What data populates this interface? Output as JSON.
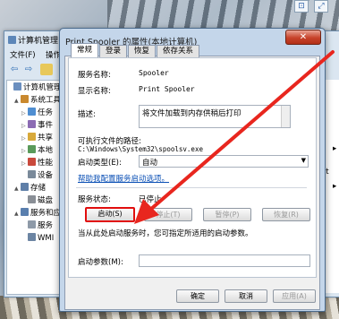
{
  "desktop": {
    "corner_buttons": [
      "⊡",
      "⤢"
    ]
  },
  "mmc": {
    "title": "计算机管理",
    "menus": [
      "文件(F)",
      "操作"
    ],
    "tree": [
      {
        "label": "计算机管理",
        "level": 0,
        "icon": "computer-icon",
        "expand": ""
      },
      {
        "label": "系统工具",
        "level": 1,
        "icon": "tools-icon",
        "expand": "▲"
      },
      {
        "label": "任务",
        "level": 2,
        "icon": "clock-icon",
        "expand": "▷"
      },
      {
        "label": "事件",
        "level": 2,
        "icon": "event-viewer-icon",
        "expand": "▷"
      },
      {
        "label": "共享",
        "level": 2,
        "icon": "share-icon",
        "expand": "▷"
      },
      {
        "label": "本地",
        "level": 2,
        "icon": "users-icon",
        "expand": "▷"
      },
      {
        "label": "性能",
        "level": 2,
        "icon": "performance-icon",
        "expand": "▷"
      },
      {
        "label": "设备",
        "level": 2,
        "icon": "device-manager-icon",
        "expand": ""
      },
      {
        "label": "存储",
        "level": 1,
        "icon": "storage-icon",
        "expand": "▲"
      },
      {
        "label": "磁盘",
        "level": 2,
        "icon": "disk-icon",
        "expand": ""
      },
      {
        "label": "服务和应",
        "level": 1,
        "icon": "services-apps-icon",
        "expand": "▲"
      },
      {
        "label": "服务",
        "level": 2,
        "icon": "services-icon",
        "expand": ""
      },
      {
        "label": "WMI",
        "level": 2,
        "icon": "wmi-icon",
        "expand": ""
      }
    ],
    "right_pane": {
      "actions_header": "作",
      "services_label": "务",
      "print_label": "Print",
      "arrow1": "▸",
      "arrow2": "▸"
    }
  },
  "dialog": {
    "title": "Print Spooler 的属性(本地计算机)",
    "close_label": "✕",
    "tabs": [
      "常规",
      "登录",
      "恢复",
      "依存关系"
    ],
    "active_tab": "常规",
    "service_name_label": "服务名称:",
    "service_name": "Spooler",
    "display_name_label": "显示名称:",
    "display_name": "Print Spooler",
    "description_label": "描述:",
    "description": "将文件加载到内存供稍后打印",
    "exe_path_label": "可执行文件的路径:",
    "exe_path": "C:\\Windows\\System32\\spoolsv.exe",
    "startup_type_label": "启动类型(E):",
    "startup_type": "自动",
    "help_link": "帮助我配置服务启动选项。",
    "status_label": "服务状态:",
    "status": "已停止",
    "buttons": {
      "start": "启动(S)",
      "stop": "停止(T)",
      "pause": "暂停(P)",
      "resume": "恢复(R)"
    },
    "hint": "当从此处启动服务时，您可指定所适用的启动参数。",
    "start_params_label": "启动参数(M):",
    "start_params": "",
    "footer": {
      "ok": "确定",
      "cancel": "取消",
      "apply": "应用(A)"
    }
  },
  "colors": {
    "highlight_box": "#e10e0e",
    "arrow": "#e8261e",
    "link": "#0a4fb5"
  }
}
